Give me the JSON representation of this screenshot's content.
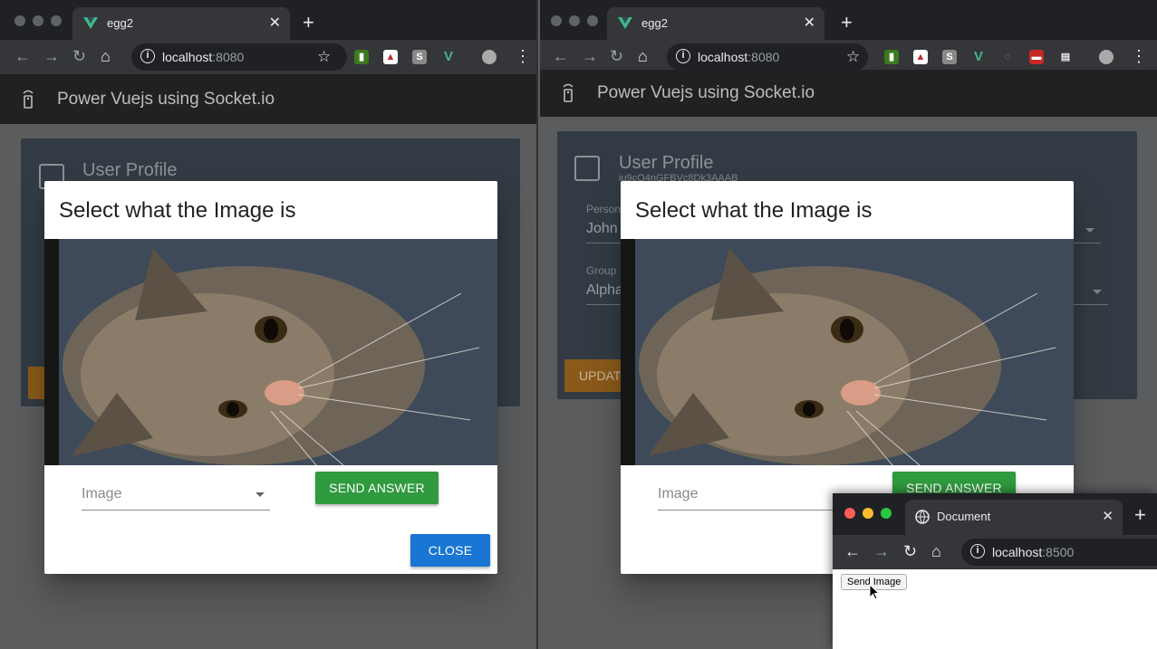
{
  "left_window": {
    "tab_title": "egg2",
    "url_host": "localhost",
    "url_port": ":8080",
    "app_title": "Power Vuejs using Socket.io",
    "card_title": "User Profile",
    "dialog": {
      "title": "Select what the Image is",
      "select_placeholder": "Image",
      "send_label": "SEND ANSWER",
      "close_label": "CLOSE"
    }
  },
  "right_window": {
    "tab_title": "egg2",
    "url_host": "localhost",
    "url_port": ":8080",
    "app_title": "Power Vuejs using Socket.io",
    "card_title": "User Profile",
    "user_id": "iu9cO4nGFBVc8Dk3AAAB",
    "person_label": "Person",
    "person_value": "John",
    "group_label": "Group",
    "group_value": "Alpha",
    "update_label": "UPDATE",
    "dialog": {
      "title": "Select what the Image is",
      "select_placeholder": "Image",
      "send_label": "SEND ANSWER"
    }
  },
  "doc_window": {
    "tab_title": "Document",
    "url_host": "localhost",
    "url_port": ":8500",
    "send_image_label": "Send Image"
  },
  "icons": [
    "vue-favicon",
    "info-icon",
    "star-icon",
    "back-icon",
    "forward-icon",
    "reload-icon",
    "home-icon",
    "globe-icon",
    "profile-icon",
    "remote-icon"
  ]
}
